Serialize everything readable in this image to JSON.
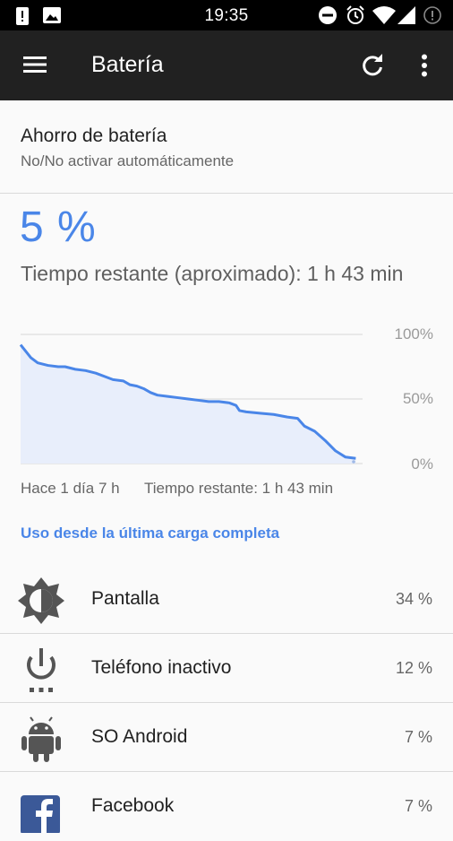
{
  "status_bar": {
    "time": "19:35",
    "icons": [
      "alert-icon",
      "image-icon",
      "do-not-disturb-icon",
      "alarm-icon",
      "wifi-icon",
      "signal-icon",
      "no-sim-icon"
    ]
  },
  "app_bar": {
    "title": "Batería",
    "icons": [
      "menu-icon",
      "refresh-icon",
      "more-vert-icon"
    ]
  },
  "battery_saver": {
    "title": "Ahorro de batería",
    "subtitle": "No/No activar automáticamente"
  },
  "battery": {
    "percent": "5 %",
    "remaining": "Tiempo restante (aproximado): 1 h 43 min"
  },
  "chart": {
    "caption_left": "Hace 1 día 7 h",
    "caption_right": "Tiempo restante: 1 h 43 min"
  },
  "chart_data": {
    "type": "area",
    "y_ticks": [
      "100%",
      "50%",
      "0%"
    ],
    "ylim": [
      0,
      100
    ],
    "x": [
      0,
      3,
      5,
      8,
      11,
      13,
      16,
      19,
      22,
      25,
      27,
      30,
      32,
      34,
      36,
      38,
      40,
      43,
      46,
      49,
      52,
      55,
      58,
      61,
      63,
      64,
      66,
      70,
      74,
      78,
      81,
      83,
      86,
      89,
      92,
      95,
      98
    ],
    "values": [
      92,
      82,
      78,
      76,
      75,
      75,
      73,
      72,
      70,
      67,
      65,
      64,
      61,
      60,
      58,
      55,
      53,
      52,
      51,
      50,
      49,
      48,
      48,
      47,
      45,
      41,
      40,
      39,
      38,
      36,
      35,
      29,
      25,
      18,
      10,
      5,
      4
    ],
    "colors": {
      "line": "#4a86e8",
      "fill": "#e8eefb",
      "grid": "#d6d6d6"
    }
  },
  "usage_link": "Uso desde la última carga completa",
  "usage_items": [
    {
      "label": "Pantalla",
      "value": "34 %",
      "icon": "brightness-icon"
    },
    {
      "label": "Teléfono inactivo",
      "value": "12 %",
      "icon": "power-idle-icon"
    },
    {
      "label": "SO Android",
      "value": "7 %",
      "icon": "android-icon"
    },
    {
      "label": "Facebook",
      "value": "7 %",
      "icon": "facebook-icon"
    }
  ]
}
